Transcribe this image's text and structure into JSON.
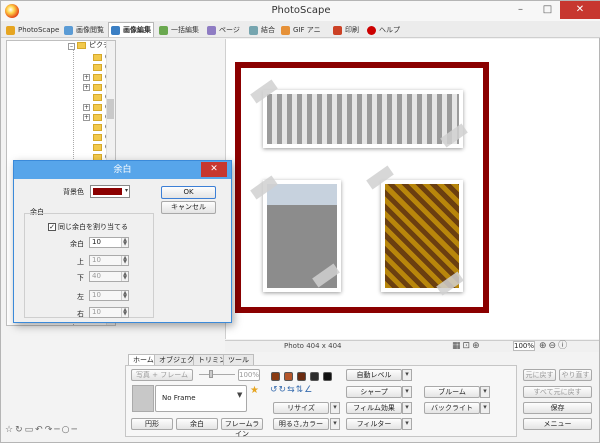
{
  "app": {
    "title": "PhotoScape"
  },
  "window_controls": {
    "minimize": "–",
    "maximize": "□",
    "close": "✕"
  },
  "tabs": [
    {
      "label": "PhotoScape",
      "color": "#e6a521"
    },
    {
      "label": "画像閲覧",
      "color": "#5a9bd5"
    },
    {
      "label": "画像編集",
      "color": "#3b7fc4"
    },
    {
      "label": "一括編集",
      "color": "#6aa84f"
    },
    {
      "label": "ページ",
      "color": "#8e7cc3"
    },
    {
      "label": "結合",
      "color": "#76a5af"
    },
    {
      "label": "GIF アニメ",
      "color": "#e69138"
    },
    {
      "label": "印刷",
      "color": "#cc4125"
    },
    {
      "label": "ヘルプ",
      "color": "#cc0000"
    }
  ],
  "tree": {
    "root_label": "ピクチ",
    "items": [
      "0",
      "0",
      "0",
      "0",
      "0",
      "0",
      "0",
      "0",
      "0",
      "0",
      "0",
      "0",
      "0",
      "0",
      "0"
    ]
  },
  "status": {
    "photo_info": "Photo 404 x 404",
    "zoom": "100%"
  },
  "panel": {
    "tabs": [
      "ホーム",
      "オブジェクト",
      "トリミング",
      "ツール"
    ],
    "photo_frame_label": "写真 + フレーム",
    "frame_value": "No Frame",
    "frame_pct": "100%",
    "buttons": {
      "round": "円形",
      "margin": "余白",
      "frame_line": "フレームライン",
      "auto_level": "自動レベル",
      "sharpen": "シャープ",
      "resize": "リサイズ",
      "film_effect": "フィルム効果",
      "bright_color": "明るさ,カラー",
      "filter": "フィルター",
      "bloom": "ブルーム",
      "backlight": "バックライト",
      "undo": "元に戻す",
      "redo": "やり直す",
      "undo_all": "すべて元に戻す",
      "save": "保存",
      "menu": "メニュー"
    },
    "swatch_colors": [
      "#8a3b12",
      "#b5562a",
      "#6b2b10",
      "#2b2b2b",
      "#111111"
    ]
  },
  "dialog": {
    "title": "余白",
    "bg_color_label": "背景色",
    "bg_color": "#8b0000",
    "ok": "OK",
    "cancel": "キャンセル",
    "group_label": "余白",
    "same_margin_label": "同じ余白を割り当てる",
    "same_margin_checked": true,
    "fields": [
      {
        "label": "余白",
        "value": "10",
        "enabled": true
      },
      {
        "label": "上",
        "value": "10",
        "enabled": false
      },
      {
        "label": "下",
        "value": "40",
        "enabled": false
      },
      {
        "label": "左",
        "value": "10",
        "enabled": false
      },
      {
        "label": "右",
        "value": "10",
        "enabled": false
      }
    ]
  }
}
